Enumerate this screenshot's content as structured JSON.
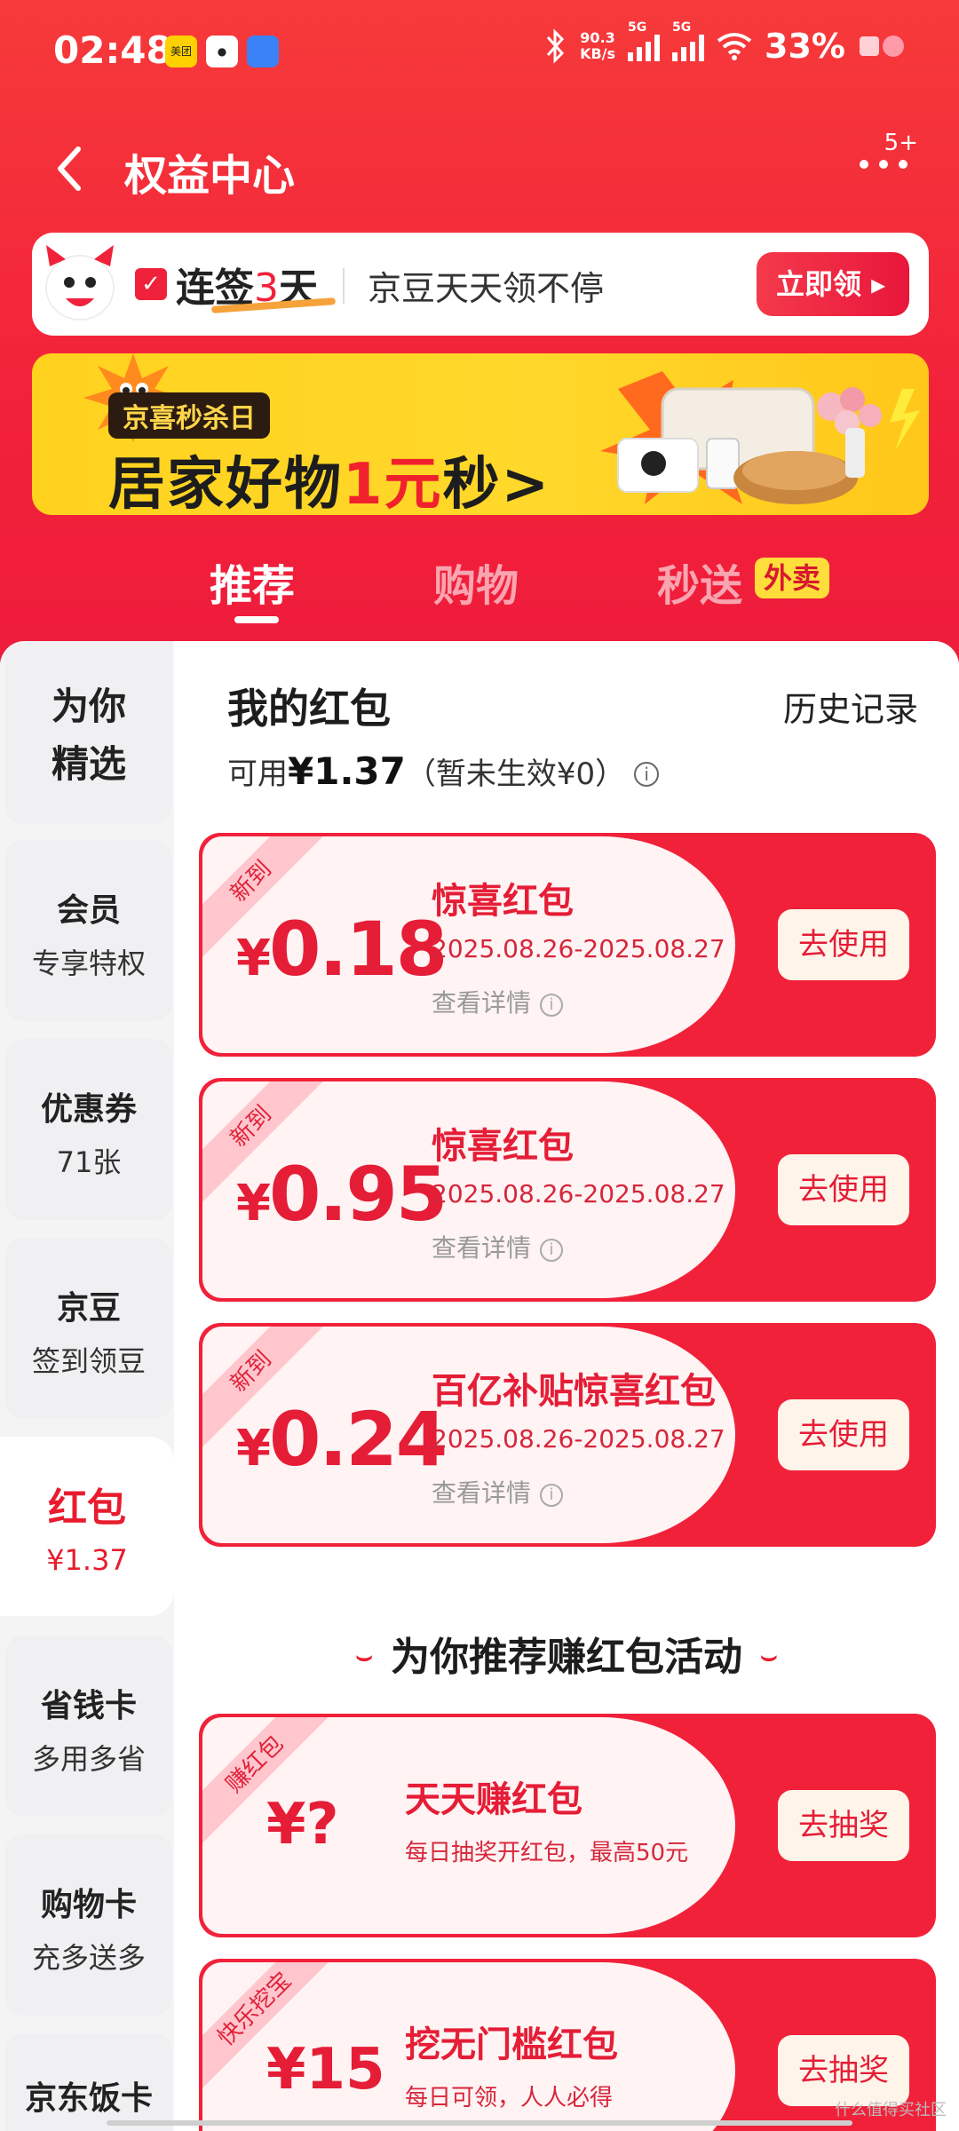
{
  "status_bar": {
    "time": "02:48",
    "net_speed_value": "90.3",
    "net_speed_unit": "KB/s",
    "signal_1": "5G",
    "signal_2": "5G",
    "battery": "33%"
  },
  "nav": {
    "title": "权益中心",
    "notification_badge": "5+"
  },
  "signin_banner": {
    "streak_prefix": "连签",
    "streak_days": "3",
    "streak_suffix": "天",
    "subtitle": "京豆天天领不停",
    "button_label": "立即领 ▸"
  },
  "promo_banner": {
    "tag": "京喜秒杀日",
    "title_pre": "居家好物",
    "title_highlight": "1元",
    "title_post": "秒>"
  },
  "tabs": [
    {
      "label": "推荐",
      "active": true
    },
    {
      "label": "购物",
      "active": false
    },
    {
      "label": "秒送",
      "active": false,
      "badge": "外卖"
    }
  ],
  "sidebar": {
    "items": [
      {
        "line1": "为你",
        "line2": "精选"
      },
      {
        "line1": "会员",
        "line2": "专享特权"
      },
      {
        "line1": "优惠券",
        "line2": "71张"
      },
      {
        "line1": "京豆",
        "line2": "签到领豆"
      },
      {
        "line1": "红包",
        "line2": "¥1.37",
        "active": true
      },
      {
        "line1": "省钱卡",
        "line2": "多用多省"
      },
      {
        "line1": "购物卡",
        "line2": "充多送多"
      },
      {
        "line1": "京东饭卡",
        "line2": ""
      }
    ]
  },
  "red_packets": {
    "title": "我的红包",
    "history_link": "历史记录",
    "available_prefix": "可用",
    "available_amount": "¥1.37",
    "pending": "（暂未生效¥0）",
    "cards": [
      {
        "tag": "新到",
        "currency": "¥",
        "amount": "0.18",
        "name": "惊喜红包",
        "date": "2025.08.26-2025.08.27",
        "detail": "查看详情",
        "button": "去使用"
      },
      {
        "tag": "新到",
        "currency": "¥",
        "amount": "0.95",
        "name": "惊喜红包",
        "date": "2025.08.26-2025.08.27",
        "detail": "查看详情",
        "button": "去使用"
      },
      {
        "tag": "新到",
        "currency": "¥",
        "amount": "0.24",
        "name": "百亿补贴惊喜红包",
        "date": "2025.08.26-2025.08.27",
        "detail": "查看详情",
        "button": "去使用"
      }
    ]
  },
  "recommend": {
    "title": "为你推荐赚红包活动",
    "activities": [
      {
        "tag": "赚红包",
        "amount": "¥?",
        "name": "天天赚红包",
        "desc": "每日抽奖开红包，最高50元",
        "button": "去抽奖"
      },
      {
        "tag": "快乐挖宝",
        "amount": "¥15",
        "name": "挖无门槛红包",
        "desc": "每日可领，人人必得",
        "button": "去抽奖"
      }
    ]
  },
  "watermark": "什么值得买社区",
  "colors": {
    "brand_red": "#f0213b",
    "card_bg": "#fff3f3",
    "button_bg": "#fff4e9",
    "takeout_yellow": "#ffdd3a"
  }
}
